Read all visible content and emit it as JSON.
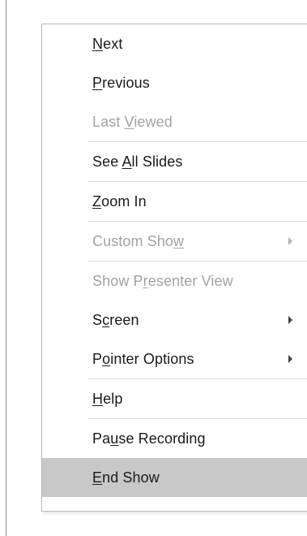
{
  "menu": {
    "items": [
      {
        "id": "next",
        "before": "",
        "key": "N",
        "after": "ext",
        "disabled": false,
        "submenu": false,
        "highlighted": false
      },
      {
        "id": "previous",
        "before": "",
        "key": "P",
        "after": "revious",
        "disabled": false,
        "submenu": false,
        "highlighted": false
      },
      {
        "id": "last-viewed",
        "before": "Last ",
        "key": "V",
        "after": "iewed",
        "disabled": true,
        "submenu": false,
        "highlighted": false
      },
      {
        "id": "see-all-slides",
        "before": "See ",
        "key": "A",
        "after": "ll Slides",
        "disabled": false,
        "submenu": false,
        "highlighted": false
      },
      {
        "id": "zoom-in",
        "before": "",
        "key": "Z",
        "after": "oom In",
        "disabled": false,
        "submenu": false,
        "highlighted": false
      },
      {
        "id": "custom-show",
        "before": "Custom Sho",
        "key": "w",
        "after": "",
        "disabled": true,
        "submenu": true,
        "highlighted": false
      },
      {
        "id": "show-presenter-view",
        "before": "Show P",
        "key": "r",
        "after": "esenter View",
        "disabled": true,
        "submenu": false,
        "highlighted": false
      },
      {
        "id": "screen",
        "before": "S",
        "key": "c",
        "after": "reen",
        "disabled": false,
        "submenu": true,
        "highlighted": false
      },
      {
        "id": "pointer-options",
        "before": "P",
        "key": "o",
        "after": "inter Options",
        "disabled": false,
        "submenu": true,
        "highlighted": false
      },
      {
        "id": "help",
        "before": "",
        "key": "H",
        "after": "elp",
        "disabled": false,
        "submenu": false,
        "highlighted": false
      },
      {
        "id": "pause-recording",
        "before": "Pa",
        "key": "u",
        "after": "se Recording",
        "disabled": false,
        "submenu": false,
        "highlighted": false
      },
      {
        "id": "end-show",
        "before": "",
        "key": "E",
        "after": "nd Show",
        "disabled": false,
        "submenu": false,
        "highlighted": true
      }
    ]
  }
}
